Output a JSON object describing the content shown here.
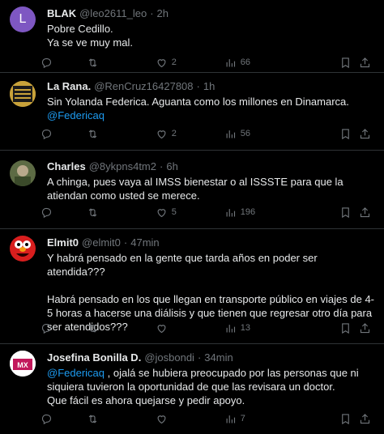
{
  "tweets": [
    {
      "name": "BLAK",
      "handle": "@leo2611_leo",
      "time": "2h",
      "avatar_letter": "L",
      "avatar_color": "#7e57c2",
      "lines": [
        "Pobre Cedillo.",
        "Ya se ve muy mal."
      ],
      "likes": "2",
      "views": "66"
    },
    {
      "name": "La Rana.",
      "handle": "@RenCruz16427808",
      "time": "1h",
      "avatar_text": "O TODO SE VOTA",
      "avatar_color": "#c8a23a",
      "lines": [
        "Sin Yolanda Federica. Aguanta como los millones en Dinamarca."
      ],
      "mention": "@Federicaq",
      "likes": "2",
      "views": "56"
    },
    {
      "name": "Charles",
      "handle": "@8ykpns4tm2",
      "time": "6h",
      "avatar_color": "#6b7a55",
      "lines": [
        "A chinga, pues vaya al IMSS bienestar o al ISSSTE para que la atiendan como usted se merece."
      ],
      "likes": "5",
      "views": "196"
    },
    {
      "name": "Elmit0",
      "handle": "@elmit0",
      "time": "47min",
      "avatar_color": "#d81e1e",
      "lines": [
        "Y habrá pensado en la gente que tarda años en poder ser atendida???",
        "",
        "Habrá pensado en los que llegan en transporte público en viajes de 4-5 horas a hacerse una diálisis y que tienen que regresar otro día para ser atendidos???"
      ],
      "views": "13"
    },
    {
      "name": "Josefina Bonilla D.",
      "handle": "@josbondi",
      "time": "34min",
      "avatar_text": "MX",
      "avatar_color": "#ffffff",
      "mention": "@Federicaq",
      "lines": [
        " ,  ojalá se hubiera preocupado por las personas que ni siquiera tuvieron la oportunidad de que las revisara un doctor.",
        "Que fácil es ahora quejarse y pedir apoyo."
      ],
      "views": "7"
    }
  ],
  "icons": {
    "reply": "reply-icon",
    "retweet": "retweet-icon",
    "like": "heart-icon",
    "views": "views-icon",
    "bookmark": "bookmark-icon",
    "share": "share-icon"
  }
}
